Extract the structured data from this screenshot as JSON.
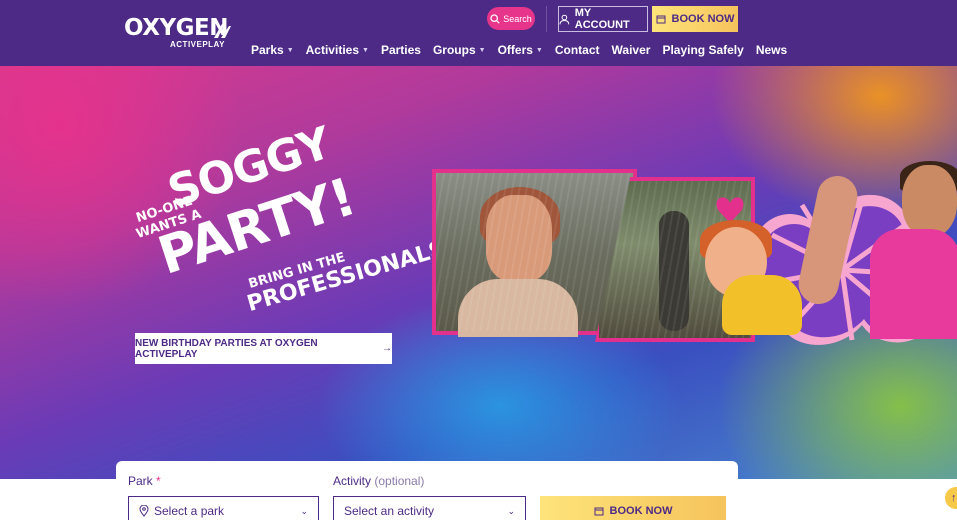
{
  "brand": {
    "name": "OXYGEN",
    "tagline": "ACTIVEPLAY",
    "colors": {
      "primary": "#4c2a85",
      "accent_pink": "#e6358b",
      "accent_yellow": "#f6c35c"
    }
  },
  "header": {
    "search_label": "Search",
    "account_label": "MY ACCOUNT",
    "book_now_label": "BOOK NOW",
    "nav": [
      {
        "label": "Parks",
        "has_dropdown": true
      },
      {
        "label": "Activities",
        "has_dropdown": true
      },
      {
        "label": "Parties",
        "has_dropdown": false
      },
      {
        "label": "Groups",
        "has_dropdown": true
      },
      {
        "label": "Offers",
        "has_dropdown": true
      },
      {
        "label": "Contact",
        "has_dropdown": false
      },
      {
        "label": "Waiver",
        "has_dropdown": false
      },
      {
        "label": "Playing Safely",
        "has_dropdown": false
      },
      {
        "label": "News",
        "has_dropdown": false
      }
    ]
  },
  "hero": {
    "headline": {
      "line1": "NO-ONE",
      "line2": "WANTS A",
      "line3": "SOGGY",
      "line4": "PARTY!",
      "line5": "BRING IN THE",
      "line6": "PROFESSIONALS."
    },
    "cta_label": "NEW BIRTHDAY PARTIES AT OXYGEN ACTIVEPLAY",
    "cta_arrow": "→"
  },
  "booking_form": {
    "park_label": "Park",
    "park_required": "*",
    "park_placeholder": "Select a park",
    "activity_label": "Activity",
    "activity_optional": "(optional)",
    "activity_placeholder": "Select an activity",
    "book_now_label": "BOOK NOW"
  },
  "scroll_top_label": "↑"
}
